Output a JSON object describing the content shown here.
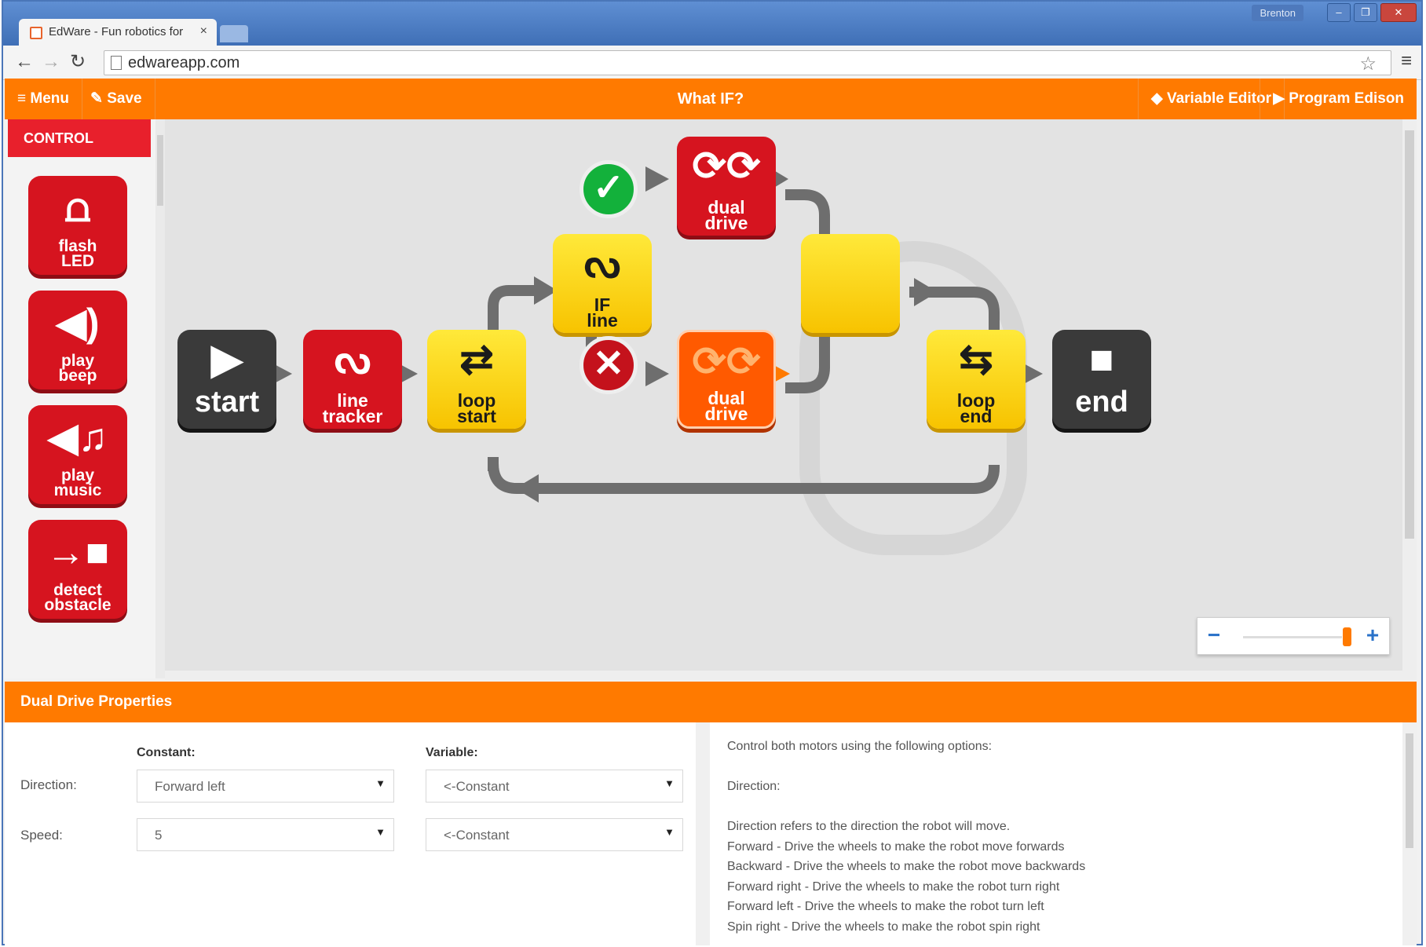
{
  "browser": {
    "tab_title": "EdWare - Fun robotics for",
    "tab_close": "×",
    "user": "Brenton",
    "url": "edwareapp.com"
  },
  "toolbar": {
    "menu_label": "Menu",
    "save_label": "Save",
    "title": "What IF?",
    "variable_editor_label": "Variable Editor",
    "program_label": "Program Edison"
  },
  "sidebar": {
    "category": "CONTROL",
    "items": [
      {
        "l1": "flash",
        "l2": "LED",
        "icon": "alarm-light-icon"
      },
      {
        "l1": "play",
        "l2": "beep",
        "icon": "speaker-icon"
      },
      {
        "l1": "play",
        "l2": "music",
        "icon": "music-note-icon"
      },
      {
        "l1": "detect",
        "l2": "obstacle",
        "icon": "obstacle-icon"
      }
    ]
  },
  "program": {
    "start": "start",
    "line_tracker": {
      "l1": "line",
      "l2": "tracker"
    },
    "loop_start": {
      "l1": "loop",
      "l2": "start"
    },
    "if_line": {
      "l1": "IF",
      "l2": "line"
    },
    "dual_drive_top": {
      "l1": "dual",
      "l2": "drive"
    },
    "dual_drive_bottom": {
      "l1": "dual",
      "l2": "drive"
    },
    "loop_end": {
      "l1": "loop",
      "l2": "end"
    },
    "end": "end"
  },
  "zoom": {
    "minus": "−",
    "plus": "+",
    "level": 0.85
  },
  "properties": {
    "title": "Dual Drive Properties",
    "constant_header": "Constant:",
    "variable_header": "Variable:",
    "direction_label": "Direction:",
    "speed_label": "Speed:",
    "direction_constant": "Forward left",
    "direction_variable": "<-Constant",
    "speed_constant": "5",
    "speed_variable": "<-Constant"
  },
  "help": {
    "lines": [
      "Control both motors using the following options:",
      "",
      "Direction:",
      "",
      "Direction refers to the direction the robot will move.",
      "Forward - Drive the wheels to make the robot move forwards",
      "Backward - Drive the wheels to make the robot move backwards",
      "Forward right - Drive the wheels to make the robot turn right",
      "Forward left - Drive the wheels to make the robot turn left",
      "Spin right - Drive the wheels to make the robot spin right"
    ]
  },
  "colors": {
    "accent": "#ff7a00",
    "control_red": "#d6141f",
    "flow_yellow": "#f7c300",
    "selected": "#ff5a00",
    "true_badge": "#13b13b",
    "false_badge": "#c4121c"
  }
}
